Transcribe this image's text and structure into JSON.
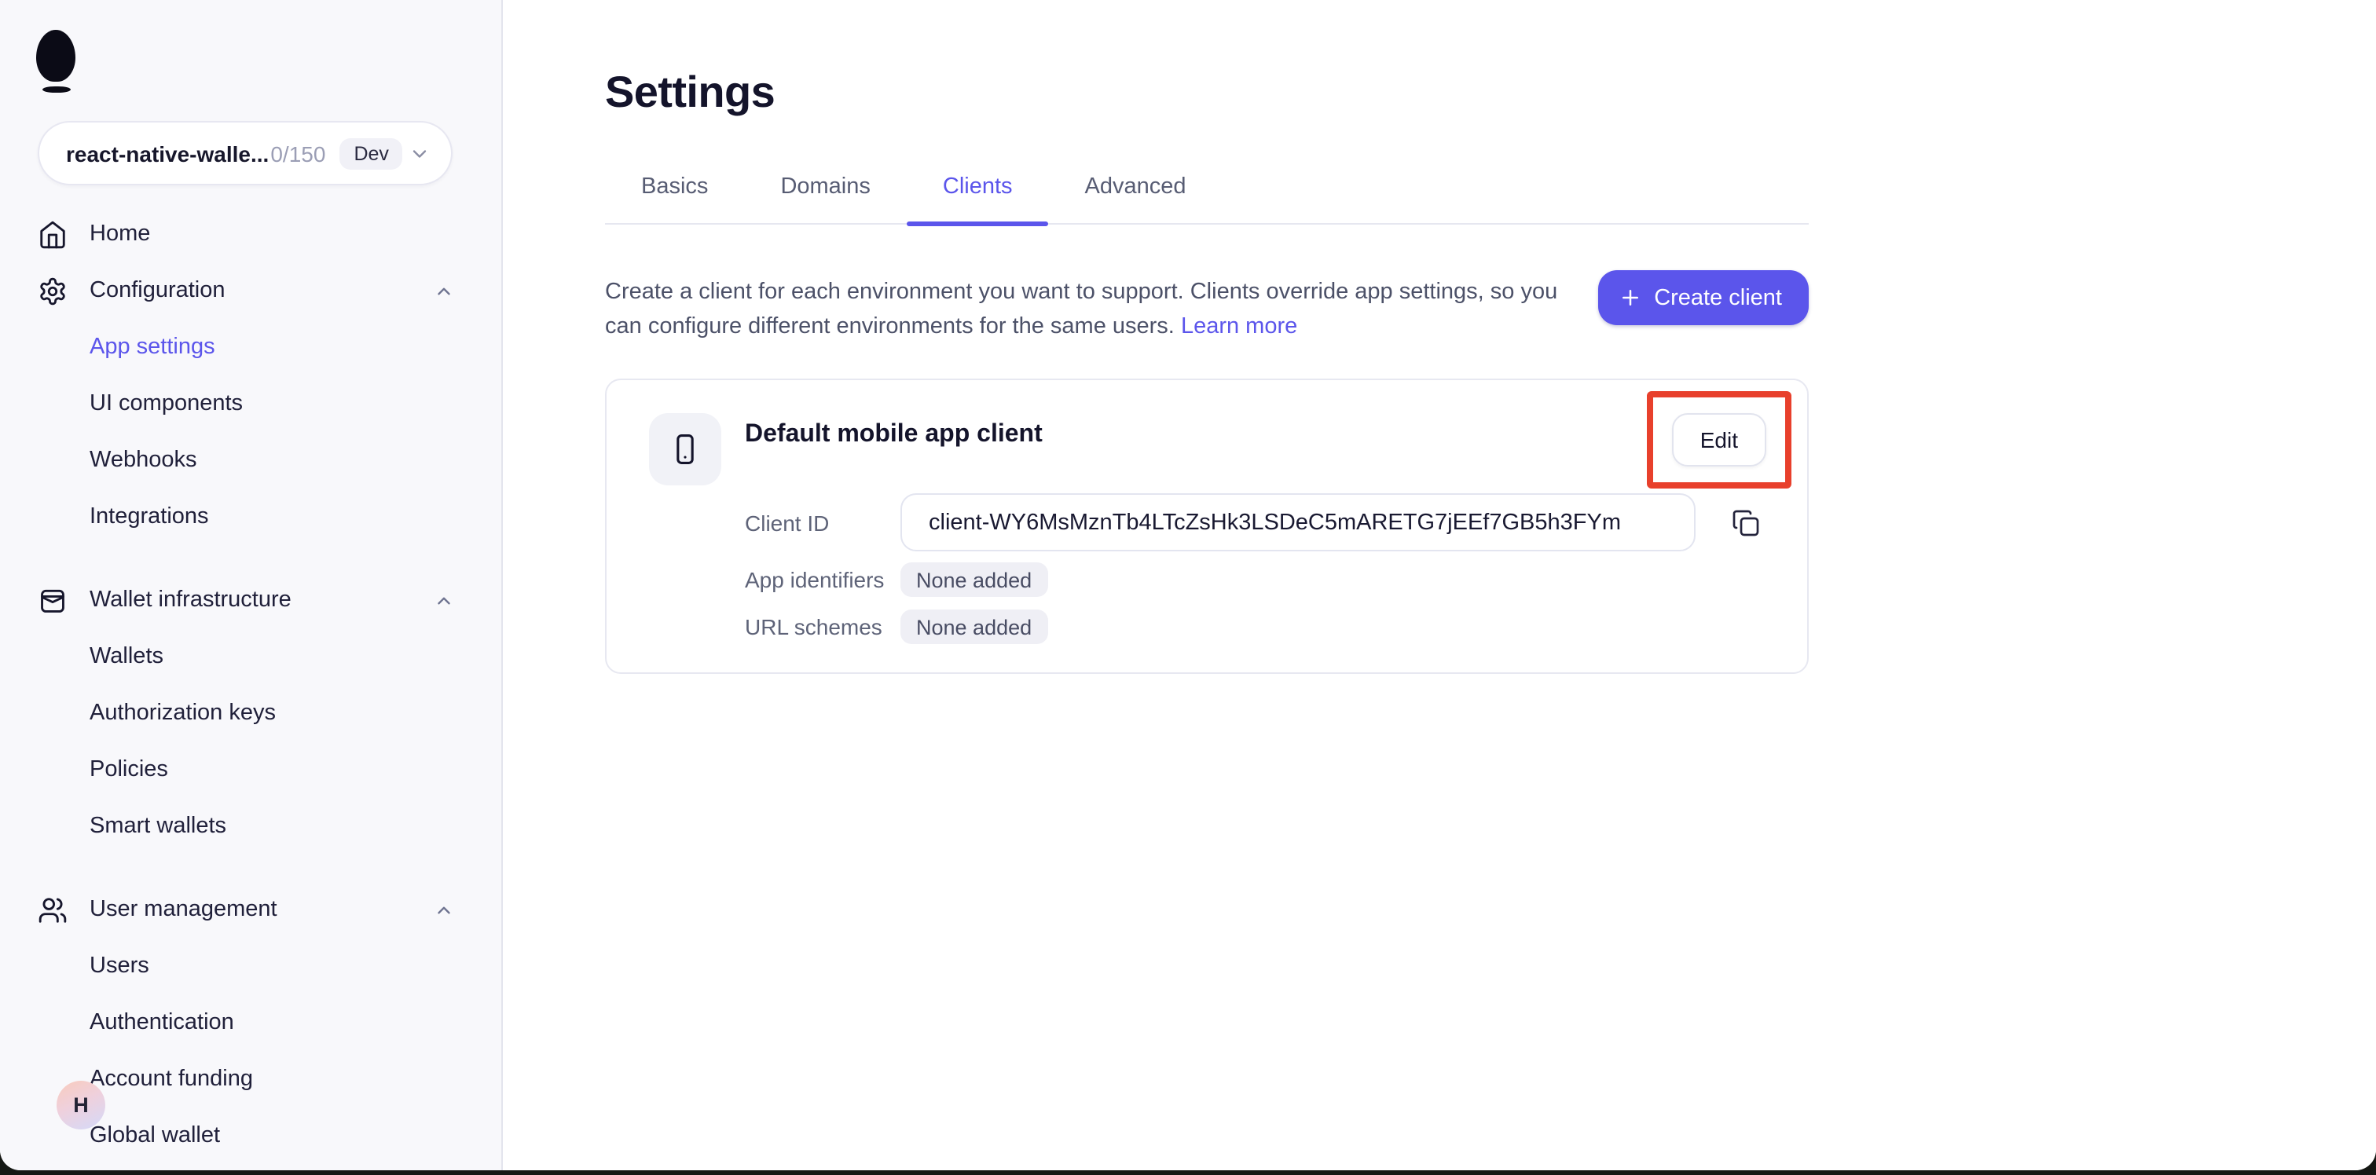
{
  "colors": {
    "accent": "#5B55EB",
    "annotation_red": "#E8402C",
    "sidebar_bg": "#F8F8FB",
    "badge_bg": "#EFEFF5",
    "text_dark": "#14142B",
    "text_slate": "#4C5168"
  },
  "icons": {
    "logo": "privy-egg-logo",
    "home": "home-icon",
    "configuration": "gear-icon",
    "wallet_infrastructure": "wallet-icon",
    "user_management": "users-icon",
    "section_collapse": "chevron-up-icon",
    "project_selector": "chevron-down-icon",
    "create_client": "plus-icon",
    "client_type": "smartphone-icon",
    "copy": "copy-icon"
  },
  "sidebar": {
    "project_selector": {
      "name": "react-native-walle...",
      "usage": "0/150",
      "badge": "Dev"
    },
    "nav": [
      {
        "label": "Home"
      },
      {
        "label": "Configuration"
      },
      {
        "label": "App settings",
        "active": true
      },
      {
        "label": "UI components"
      },
      {
        "label": "Webhooks"
      },
      {
        "label": "Integrations"
      },
      {
        "label": "Wallet infrastructure"
      },
      {
        "label": "Wallets"
      },
      {
        "label": "Authorization keys"
      },
      {
        "label": "Policies"
      },
      {
        "label": "Smart wallets"
      },
      {
        "label": "User management"
      },
      {
        "label": "Users"
      },
      {
        "label": "Authentication"
      },
      {
        "label": "Account funding"
      },
      {
        "label": "Global wallet"
      }
    ],
    "avatar_initial": "H"
  },
  "main": {
    "title": "Settings",
    "tabs": [
      {
        "label": "Basics"
      },
      {
        "label": "Domains"
      },
      {
        "label": "Clients",
        "active": true
      },
      {
        "label": "Advanced"
      }
    ],
    "clients": {
      "description": "Create a client for each environment you want to support. Clients override app settings, so you can configure different environments for the same users.",
      "learn_more": "Learn more",
      "create_button": "Create client",
      "card": {
        "title": "Default mobile app client",
        "edit_button": "Edit",
        "client_id_label": "Client ID",
        "client_id_value": "client-WY6MsMznTb4LTcZsHk3LSDeC5mARETG7jEEf7GB5h3FYm",
        "app_identifiers_label": "App identifiers",
        "app_identifiers_value": "None added",
        "url_schemes_label": "URL schemes",
        "url_schemes_value": "None added"
      }
    }
  }
}
